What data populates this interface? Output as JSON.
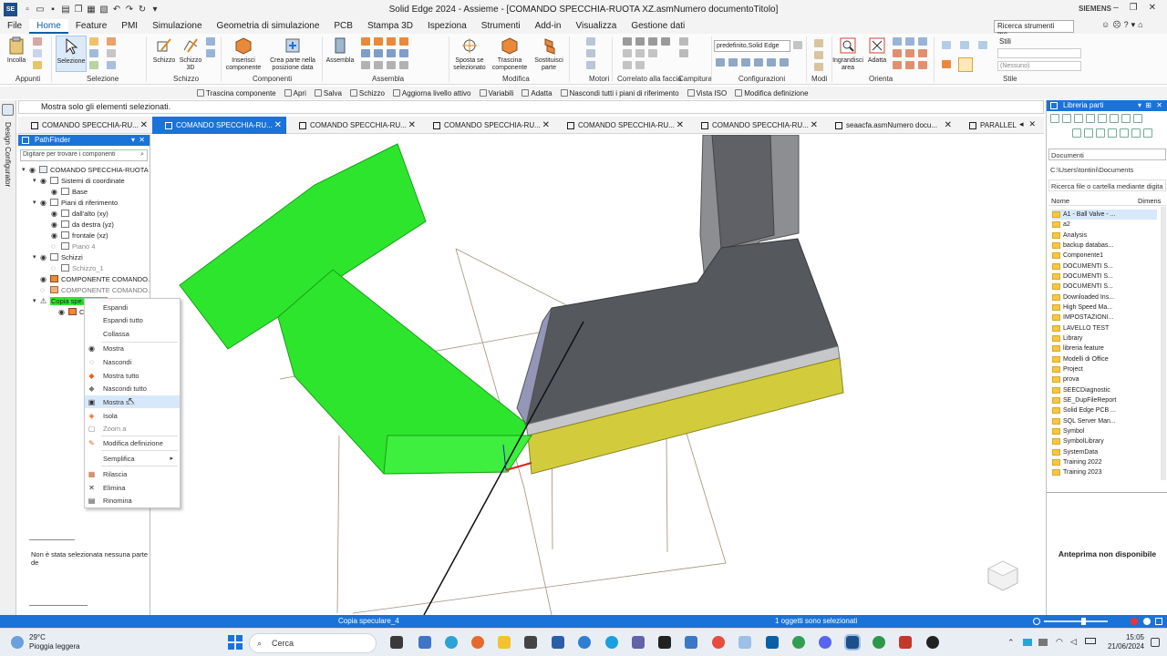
{
  "window": {
    "title": "Solid Edge 2024 - Assieme - [COMANDO SPECCHIA-RUOTA XZ.asmNumero documentoTitolo]",
    "brand": "SIEMENS",
    "app_logo": "SE"
  },
  "menu": {
    "items": [
      "File",
      "Home",
      "Feature",
      "PMI",
      "Simulazione",
      "Geometria di simulazione",
      "PCB",
      "Stampa 3D",
      "Ispeziona",
      "Strumenti",
      "Add-in",
      "Visualizza",
      "Gestione dati"
    ],
    "active": "Home",
    "search_placeholder": "Ricerca strumenti me..."
  },
  "ribbon": {
    "groups": {
      "appunti": "Appunti",
      "selezione": "Selezione",
      "schizzo": "Schizzo",
      "componenti": "Componenti",
      "assembla": "Assembla",
      "modifica": "Modifica",
      "motori": "Motori",
      "correlato": "Correlato alla faccia",
      "campitura": "Campitura",
      "configurazioni": "Configurazioni",
      "modi": "Modi",
      "orienta": "Orienta",
      "stile": "Stile"
    },
    "buttons": {
      "incolla": "Incolla",
      "selezione": "Selezione",
      "schizzo": "Schizzo",
      "schizzo3d": "Schizzo 3D",
      "inserisci": "Inserisci componente",
      "crea_parte": "Crea parte nella posizione data",
      "assembla": "Assembla",
      "sposta": "Sposta se selezionato",
      "trascina": "Trascina componente",
      "sostituisci": "Sostituisci parte",
      "ingrandisci": "Ingrandisci area",
      "adatta": "Adatta",
      "stili_label": "Stili",
      "config_value": "predefinito,Solid Edge",
      "stile_value": "(Nessuno)"
    }
  },
  "command_bar": {
    "items": [
      "Trascina componente",
      "Apri",
      "Salva",
      "Schizzo",
      "Aggiorna livello attivo",
      "Variabili",
      "Adatta",
      "Nascondi tutti i piani di riferimento",
      "Vista ISO",
      "Modifica definizione"
    ]
  },
  "prompt": {
    "text": "Mostra solo gli elementi selezionati."
  },
  "left_strip": {
    "label": "Design Configurator"
  },
  "tabs": {
    "items": [
      "COMANDO SPECCHIA-RU...",
      "COMANDO SPECCHIA-RU...",
      "COMANDO SPECCHIA-RU...",
      "COMANDO SPECCHIA-RU...",
      "COMANDO SPECCHIA-RU...",
      "COMANDO SPECCHIA-RU...",
      "seaacfa.asmNumero docu...",
      "PARALLEL"
    ],
    "active_index": 1
  },
  "pathfinder": {
    "title": "PathFinder",
    "search_placeholder": "Digitare per trovare i componenti",
    "tree": [
      {
        "label": "COMANDO SPECCHIA-RUOTA XZ...",
        "level": 0
      },
      {
        "label": "Sistemi di coordinate",
        "level": 1
      },
      {
        "label": "Base",
        "level": 2
      },
      {
        "label": "Piani di riferimento",
        "level": 1
      },
      {
        "label": "dall'alto (xy)",
        "level": 2
      },
      {
        "label": "da destra (yz)",
        "level": 2
      },
      {
        "label": "frontale (xz)",
        "level": 2
      },
      {
        "label": "Piano 4",
        "level": 2
      },
      {
        "label": "Schizzi",
        "level": 1
      },
      {
        "label": "Schizzo_1",
        "level": 2
      },
      {
        "label": "COMPONENTE COMANDO...",
        "level": 1
      },
      {
        "label": "COMPONENTE COMANDO...",
        "level": 1
      },
      {
        "label": "Copia spe...",
        "level": 1
      },
      {
        "label": "C",
        "level": 2
      }
    ],
    "message": "Non è stata selezionata nessuna parte de"
  },
  "context_menu": {
    "items": [
      {
        "label": "Espandi"
      },
      {
        "label": "Espandi tutto"
      },
      {
        "label": "Collassa"
      },
      {
        "label": "Mostra"
      },
      {
        "label": "Nascondi"
      },
      {
        "label": "Mostra tutto"
      },
      {
        "label": "Nascondi tutto"
      },
      {
        "label": "Mostra s..."
      },
      {
        "label": "Isola"
      },
      {
        "label": "Zoom a"
      },
      {
        "label": "Modifica definizione"
      },
      {
        "label": "Semplifica"
      },
      {
        "label": "Rilascia"
      },
      {
        "label": "Elimina"
      },
      {
        "label": "Rinomina"
      }
    ]
  },
  "library": {
    "title": "Libreria parti",
    "location": "Documenti",
    "path": "C:\\Users\\tontini\\Documents",
    "search_placeholder": "Ricerca file o cartella mediante digita",
    "col_name": "Nome",
    "col_size": "Dimens",
    "items": [
      "A1 - Ball Valve - ...",
      "a2",
      "Analysis",
      "backup databas...",
      "Componente1",
      "DOCUMENTI S...",
      "DOCUMENTI S...",
      "DOCUMENTI S...",
      "Downloaded Ins...",
      "High Speed Ma...",
      "IMPOSTAZIONI...",
      "LAVELLO TEST",
      "Library",
      "libreria feature",
      "Modelli di Office",
      "Project",
      "prova",
      "SEECDiagnostic",
      "SE_DupFileReport",
      "Solid Edge PCB ...",
      "SQL Server Man...",
      "Symbol",
      "SymbolLibrary",
      "SystemData",
      "Training 2022",
      "Training 2023"
    ],
    "preview_text": "Anteprima non disponibile"
  },
  "status": {
    "left": "Copia speculare_4",
    "center": "1 oggetti sono selezionati"
  },
  "taskbar": {
    "weather_temp": "29°C",
    "weather_desc": "Pioggia leggera",
    "search": "Cerca",
    "time": "15:05",
    "date": "21/06/2024"
  },
  "colors": {
    "accent": "#1a73d9",
    "selected_green": "#2ee52e",
    "part_dark": "#5a5d61",
    "part_yellow": "#d2cc3c"
  }
}
